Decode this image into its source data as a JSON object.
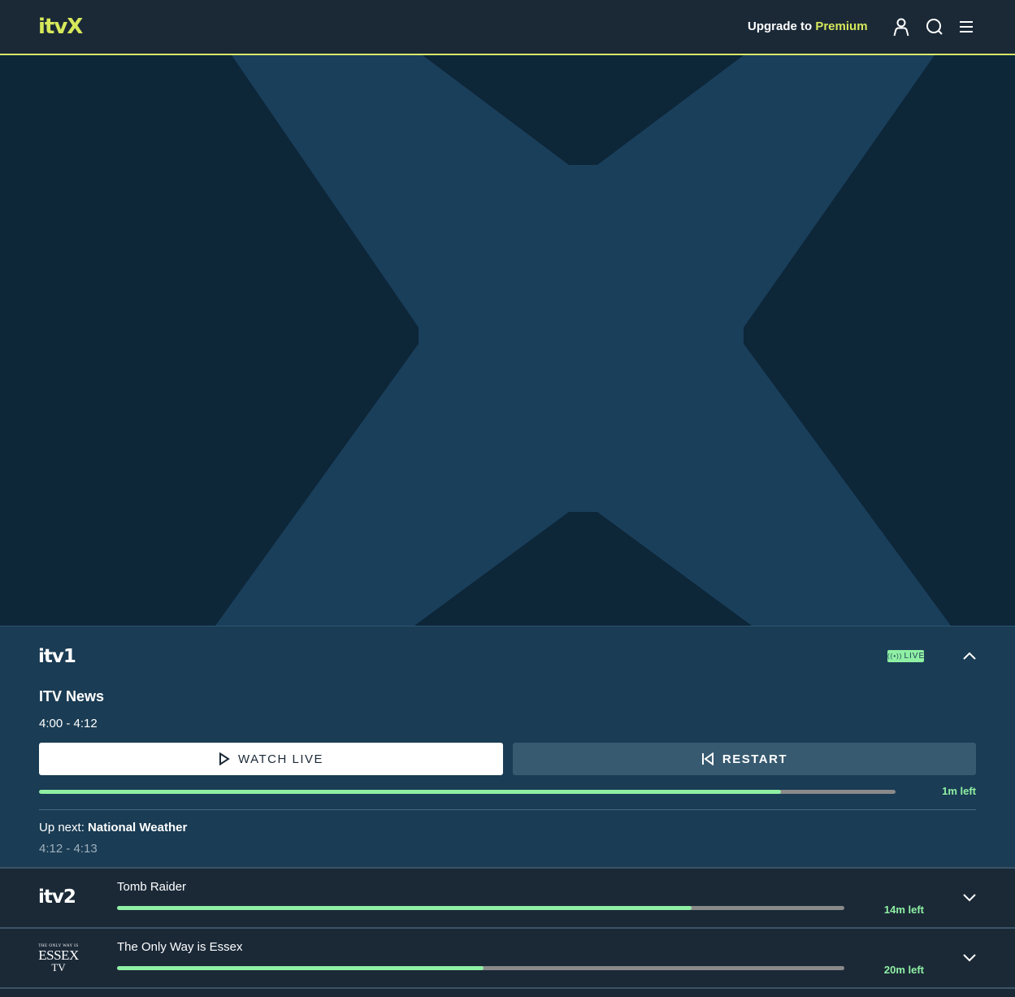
{
  "header": {
    "logo": "itvX",
    "upgrade_prefix": "Upgrade to ",
    "upgrade_highlight": "Premium",
    "icons": [
      "account-icon",
      "search-icon",
      "menu-icon"
    ]
  },
  "live": {
    "channel": "itv1",
    "badge": "LIVE",
    "programme": "ITV News",
    "time": "4:00 - 4:12",
    "watch_label": "WATCH LIVE",
    "restart_label": "RESTART",
    "progress": 0.866,
    "time_left": "1m left",
    "upnext_label": "Up next:",
    "upnext_title": "National Weather",
    "upnext_time": "4:12 - 4:13"
  },
  "channels": [
    {
      "logo": "itv2",
      "title": "Tomb Raider",
      "progress": 0.79,
      "time_left": "14m left"
    },
    {
      "logo_lines": [
        "THE ONLY WAY IS",
        "ESSEX",
        "TV"
      ],
      "title": "The Only Way is Essex",
      "progress": 0.504,
      "time_left": "20m left"
    }
  ],
  "colors": {
    "accent": "#d6e85a",
    "progress": "#8ff0a4",
    "header_bg": "#1b2937",
    "hero_bg": "#0d2638",
    "hero_x": "#1a3f5b",
    "panel_bg": "#1a3c54"
  }
}
